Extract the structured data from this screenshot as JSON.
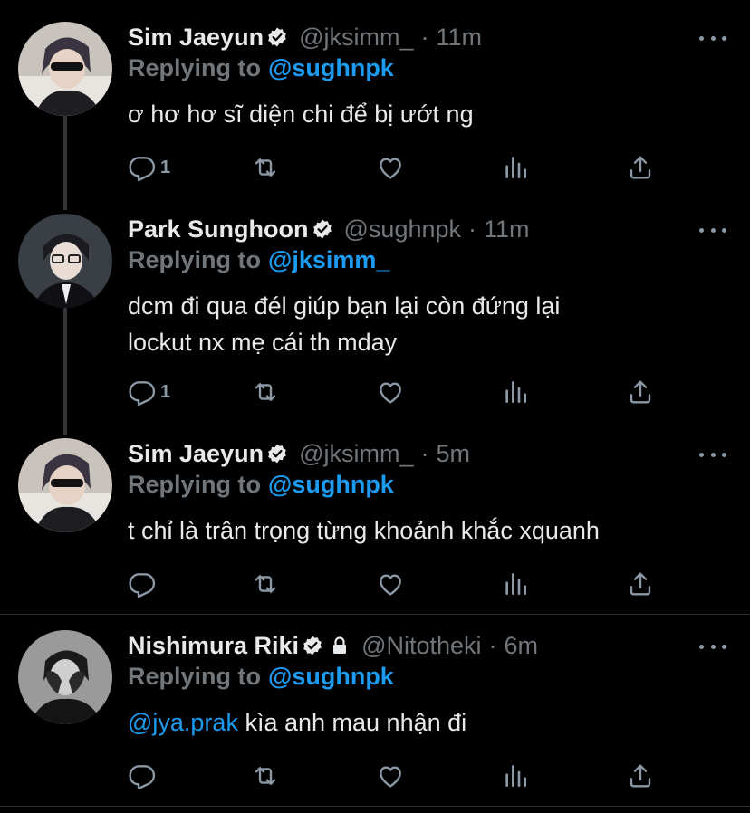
{
  "tweets": [
    {
      "name": "Sim Jaeyun",
      "handle": "@jksimm_",
      "dot": "·",
      "time": "11m",
      "replying_prefix": "Replying to",
      "replying_to": "@sughnpk",
      "text": "ơ hơ hơ sĩ diện chi để bị ướt ng",
      "reply_count": "1"
    },
    {
      "name": "Park Sunghoon",
      "handle": "@sughnpk",
      "dot": "·",
      "time": "11m",
      "replying_prefix": "Replying to",
      "replying_to": "@jksimm_",
      "text_line1": "dcm đi qua đél giúp bạn lại còn đứng lại",
      "text_line2": "lockut nx mẹ cái th mday",
      "reply_count": "1"
    },
    {
      "name": "Sim Jaeyun",
      "handle": "@jksimm_",
      "dot": "·",
      "time": "5m",
      "replying_prefix": "Replying to",
      "replying_to": "@sughnpk",
      "text": "t chỉ là trân trọng từng khoảnh khắc xquanh",
      "reply_count": ""
    },
    {
      "name": "Nishimura Riki",
      "handle": "@Nitotheki",
      "dot": "·",
      "time": "6m",
      "replying_prefix": "Replying to",
      "replying_to": "@sughnpk",
      "mention": "@jya.prak",
      "text": " kìa anh mau nhận đi",
      "reply_count": ""
    }
  ],
  "icons": {
    "reply": "reply-icon",
    "retweet": "retweet-icon",
    "like": "heart-icon",
    "views": "analytics-icon",
    "share": "share-icon",
    "verified": "verified-badge-icon",
    "lock": "lock-icon",
    "more": "more-icon"
  },
  "colors": {
    "background": "#000000",
    "text": "#e7e9ea",
    "muted": "#71767b",
    "accent": "#1d9bf0",
    "icon": "#8b98a5"
  }
}
